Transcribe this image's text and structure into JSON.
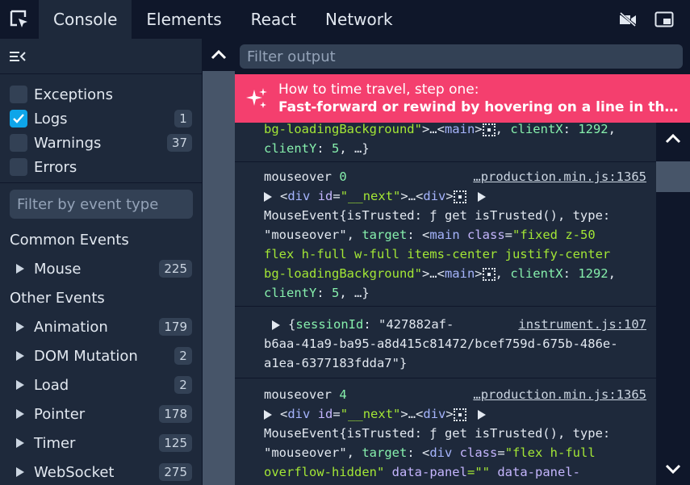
{
  "tabs": [
    {
      "label": "Console",
      "active": true
    },
    {
      "label": "Elements"
    },
    {
      "label": "React"
    },
    {
      "label": "Network"
    }
  ],
  "top_icons": [
    "cursor-select-icon",
    "video-off-icon",
    "picture-in-picture-icon"
  ],
  "sidebar": {
    "filters": [
      {
        "label": "Exceptions",
        "checked": false,
        "count": ""
      },
      {
        "label": "Logs",
        "checked": true,
        "count": "1"
      },
      {
        "label": "Warnings",
        "checked": false,
        "count": "37"
      },
      {
        "label": "Errors",
        "checked": false,
        "count": ""
      }
    ],
    "filter_placeholder": "Filter by event type",
    "common_title": "Common Events",
    "common_events": [
      {
        "label": "Mouse",
        "count": "225"
      }
    ],
    "other_title": "Other Events",
    "other_events": [
      {
        "label": "Animation",
        "count": "179"
      },
      {
        "label": "DOM Mutation",
        "count": "2"
      },
      {
        "label": "Load",
        "count": "2"
      },
      {
        "label": "Pointer",
        "count": "178"
      },
      {
        "label": "Timer",
        "count": "125"
      },
      {
        "label": "WebSocket",
        "count": "275"
      }
    ]
  },
  "console": {
    "filter_placeholder": "Filter output",
    "banner_title": "How to time travel, step one:",
    "banner_body": "Fast-forward or rewind by hovering on a line in the con...",
    "logs": {
      "a_l1_attr": "bg-loadingBackground\"",
      "a_l1_rest": ">…<",
      "a_l1_tag": "main",
      "a_l1_key": "clientX",
      "a_l1_val": "1292",
      "a_l2_key": "clientY",
      "a_l2_val": "5",
      "b_event": "mouseover",
      "b_num": "0",
      "b_src": "…production.min.js:1365",
      "b_div": "div",
      "b_id_attr": "id",
      "b_id_val": "\"__next\"",
      "b_l3": "MouseEvent{isTrusted: ƒ get isTrusted(), type:",
      "b_l4_str": "\"mouseover\"",
      "b_l4_key": "target",
      "b_l4_tag": "main",
      "b_l4_class": "class",
      "b_l4_cls1": "\"fixed z-50",
      "b_l5": "flex h-full w-full items-center justify-center",
      "b_l6_attr": "bg-loadingBackground\"",
      "b_l6_key": "clientX",
      "b_l6_val": "1292",
      "b_l7_key": "clientY",
      "b_l7_val": "5",
      "c_key": "sessionId",
      "c_val1": "\"427882af-",
      "c_src": "instrument.js:107",
      "c_l2": "b6aa-41a9-ba95-a8d415c81472/bcef759d-675b-486e-",
      "c_l3": "a1ea-6377183fdda7\"}",
      "d_event": "mouseover",
      "d_num": "4",
      "d_src": "…production.min.js:1365",
      "d_l3": "MouseEvent{isTrusted: ƒ get isTrusted(), type:",
      "d_l4_str": "\"mouseover\"",
      "d_l4_key": "target",
      "d_l4_tag": "div",
      "d_l4_class": "class",
      "d_l4_cls": "\"flex h-full",
      "d_l5a": "overflow-hidden\"",
      "d_l5b": "data-panel",
      "d_l5c": "=\"\"",
      "d_l5d": "data-panel-"
    }
  }
}
